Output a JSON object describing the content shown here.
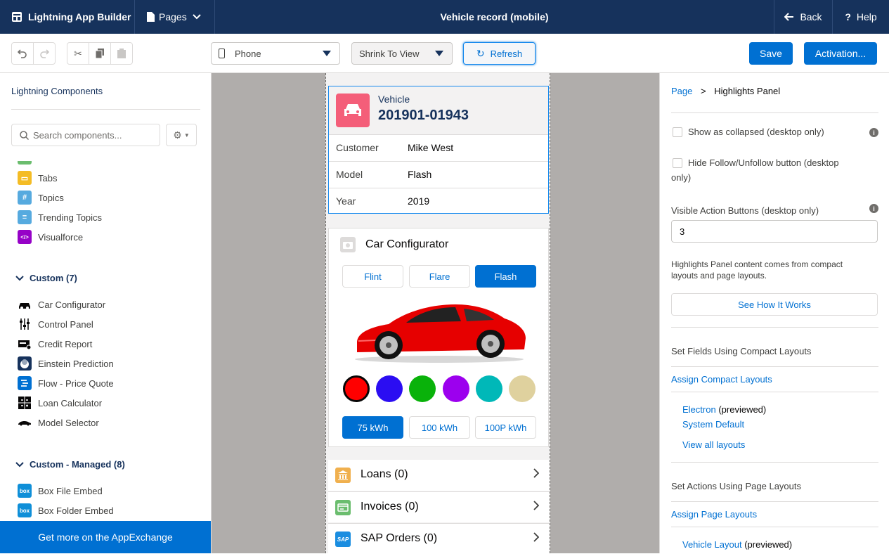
{
  "topbar": {
    "app_name": "Lightning App Builder",
    "pages_label": "Pages",
    "page_title": "Vehicle record (mobile)",
    "back_label": "Back",
    "help_label": "Help"
  },
  "toolbar": {
    "device": "Phone",
    "zoom": "Shrink To View",
    "refresh": "Refresh",
    "save": "Save",
    "activation": "Activation..."
  },
  "left_panel": {
    "title": "Lightning Components",
    "search_placeholder": "Search components...",
    "standard_items": [
      {
        "label": "Tabs",
        "icon": "tabs-icon",
        "color": "#f4bc25"
      },
      {
        "label": "Topics",
        "icon": "hashtag-icon",
        "color": "#56aadf"
      },
      {
        "label": "Trending Topics",
        "icon": "list-icon",
        "color": "#56aadf"
      },
      {
        "label": "Visualforce",
        "icon": "code-icon",
        "color": "#9602c7"
      }
    ],
    "custom_section": "Custom (7)",
    "custom_items": [
      {
        "label": "Car Configurator",
        "icon": "car-icon"
      },
      {
        "label": "Control Panel",
        "icon": "sliders-icon"
      },
      {
        "label": "Credit Report",
        "icon": "report-icon"
      },
      {
        "label": "Einstein Prediction",
        "icon": "einstein-icon"
      },
      {
        "label": "Flow - Price Quote",
        "icon": "flow-icon"
      },
      {
        "label": "Loan Calculator",
        "icon": "calculator-icon"
      },
      {
        "label": "Model Selector",
        "icon": "car-side-icon"
      }
    ],
    "managed_section": "Custom - Managed (8)",
    "managed_items": [
      {
        "label": "Box File Embed",
        "icon": "box-icon"
      },
      {
        "label": "Box Folder Embed",
        "icon": "box-icon"
      }
    ],
    "appexchange": "Get more on the AppExchange"
  },
  "highlights": {
    "object_type": "Vehicle",
    "record_name": "201901-01943",
    "fields": [
      {
        "label": "Customer",
        "value": "Mike West",
        "is_link": true
      },
      {
        "label": "Model",
        "value": "Flash",
        "is_link": false
      },
      {
        "label": "Year",
        "value": "2019",
        "is_link": false
      }
    ]
  },
  "car_configurator": {
    "title": "Car Configurator",
    "trims": [
      "Flint",
      "Flare",
      "Flash"
    ],
    "selected_trim": "Flash",
    "colors": [
      "#ff0000",
      "#2b0df2",
      "#09b20a",
      "#9c00ee",
      "#00b8b8",
      "#dfd19e"
    ],
    "selected_color": "#ff0000",
    "batteries": [
      "75 kWh",
      "100 kWh",
      "100P kWh"
    ],
    "selected_battery": "75 kWh"
  },
  "related_lists": [
    {
      "label": "Loans (0)",
      "icon": "bank-icon",
      "color": "#f0b04e"
    },
    {
      "label": "Invoices (0)",
      "icon": "invoice-icon",
      "color": "#6bbd6e"
    },
    {
      "label": "SAP Orders (0)",
      "icon": "sap-icon",
      "color": "#1a8de0"
    }
  ],
  "properties": {
    "breadcrumb_root": "Page",
    "breadcrumb_sep": ">",
    "breadcrumb_current": "Highlights Panel",
    "show_collapsed": "Show as collapsed (desktop only)",
    "hide_follow": "Hide Follow/Unfollow button (desktop only)",
    "visible_actions_label": "Visible Action Buttons (desktop only)",
    "visible_actions_value": "3",
    "info_text": "Highlights Panel content comes from compact layouts and page layouts.",
    "how_it_works": "See How It Works",
    "compact_heading": "Set Fields Using Compact Layouts",
    "assign_compact": "Assign Compact Layouts",
    "compact_layouts": [
      {
        "name": "Electron",
        "note": "(previewed)"
      },
      {
        "name": "System Default",
        "note": ""
      }
    ],
    "view_all": "View all layouts",
    "actions_heading": "Set Actions Using Page Layouts",
    "assign_page": "Assign Page Layouts",
    "page_layout_name": "Vehicle Layout",
    "page_layout_note": "(previewed)"
  }
}
